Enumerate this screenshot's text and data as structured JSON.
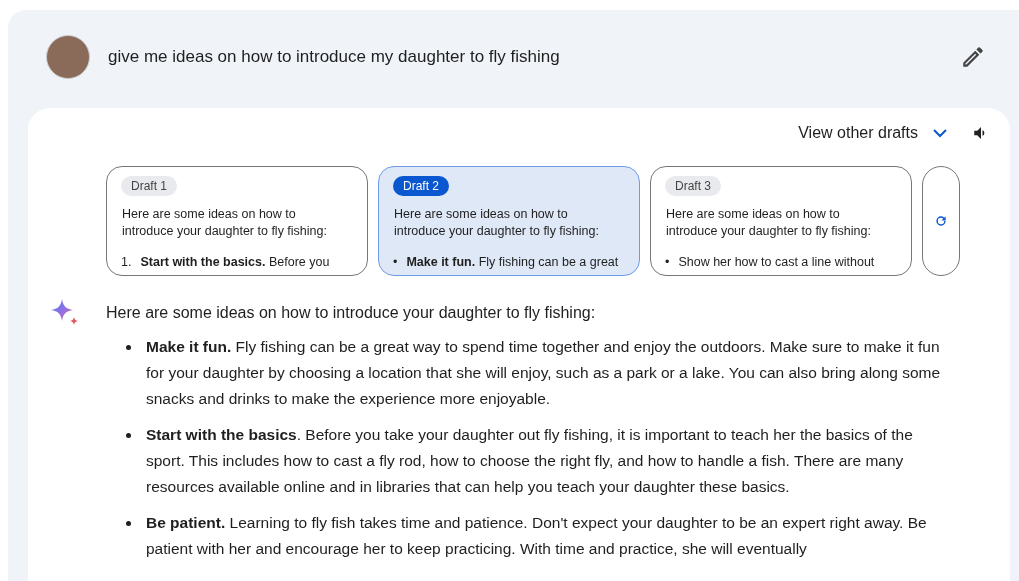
{
  "prompt": {
    "text": "give me ideas on how to introduce my daughter to fly fishing"
  },
  "drafts_header": {
    "label": "View other drafts"
  },
  "drafts": [
    {
      "label": "Draft 1",
      "selected": false,
      "intro": "Here are some ideas on how to introduce your daughter to fly fishing:",
      "marker": "1.",
      "first_point": "**Start with the basics.** Before you"
    },
    {
      "label": "Draft 2",
      "selected": true,
      "intro": "Here are some ideas on how to introduce your daughter to fly fishing:",
      "marker": "•",
      "first_point": "**Make it fun.** Fly fishing can be a great"
    },
    {
      "label": "Draft 3",
      "selected": false,
      "intro": "Here are some ideas on how to introduce your daughter to fly fishing:",
      "marker": "•",
      "first_point": "Show her how to cast a line without"
    }
  ],
  "response": {
    "intro": "Here are some ideas on how to introduce your daughter to fly fishing:",
    "points": [
      "**Make it fun.** Fly fishing can be a great way to spend time together and enjoy the outdoors. Make sure to make it fun for your daughter by choosing a location that she will enjoy, such as a park or a lake. You can also bring along some snacks and drinks to make the experience more enjoyable.",
      "**Start with the basics**. Before you take your daughter out fly fishing, it is important to teach her the basics of the sport. This includes how to cast a fly rod, how to choose the right fly, and how to handle a fish. There are many resources available online and in libraries that can help you teach your daughter these basics.",
      "**Be patient.** Learning to fly fish takes time and patience. Don't expect your daughter to be an expert right away. Be patient with her and encourage her to keep practicing. With time and practice, she will eventually"
    ]
  }
}
